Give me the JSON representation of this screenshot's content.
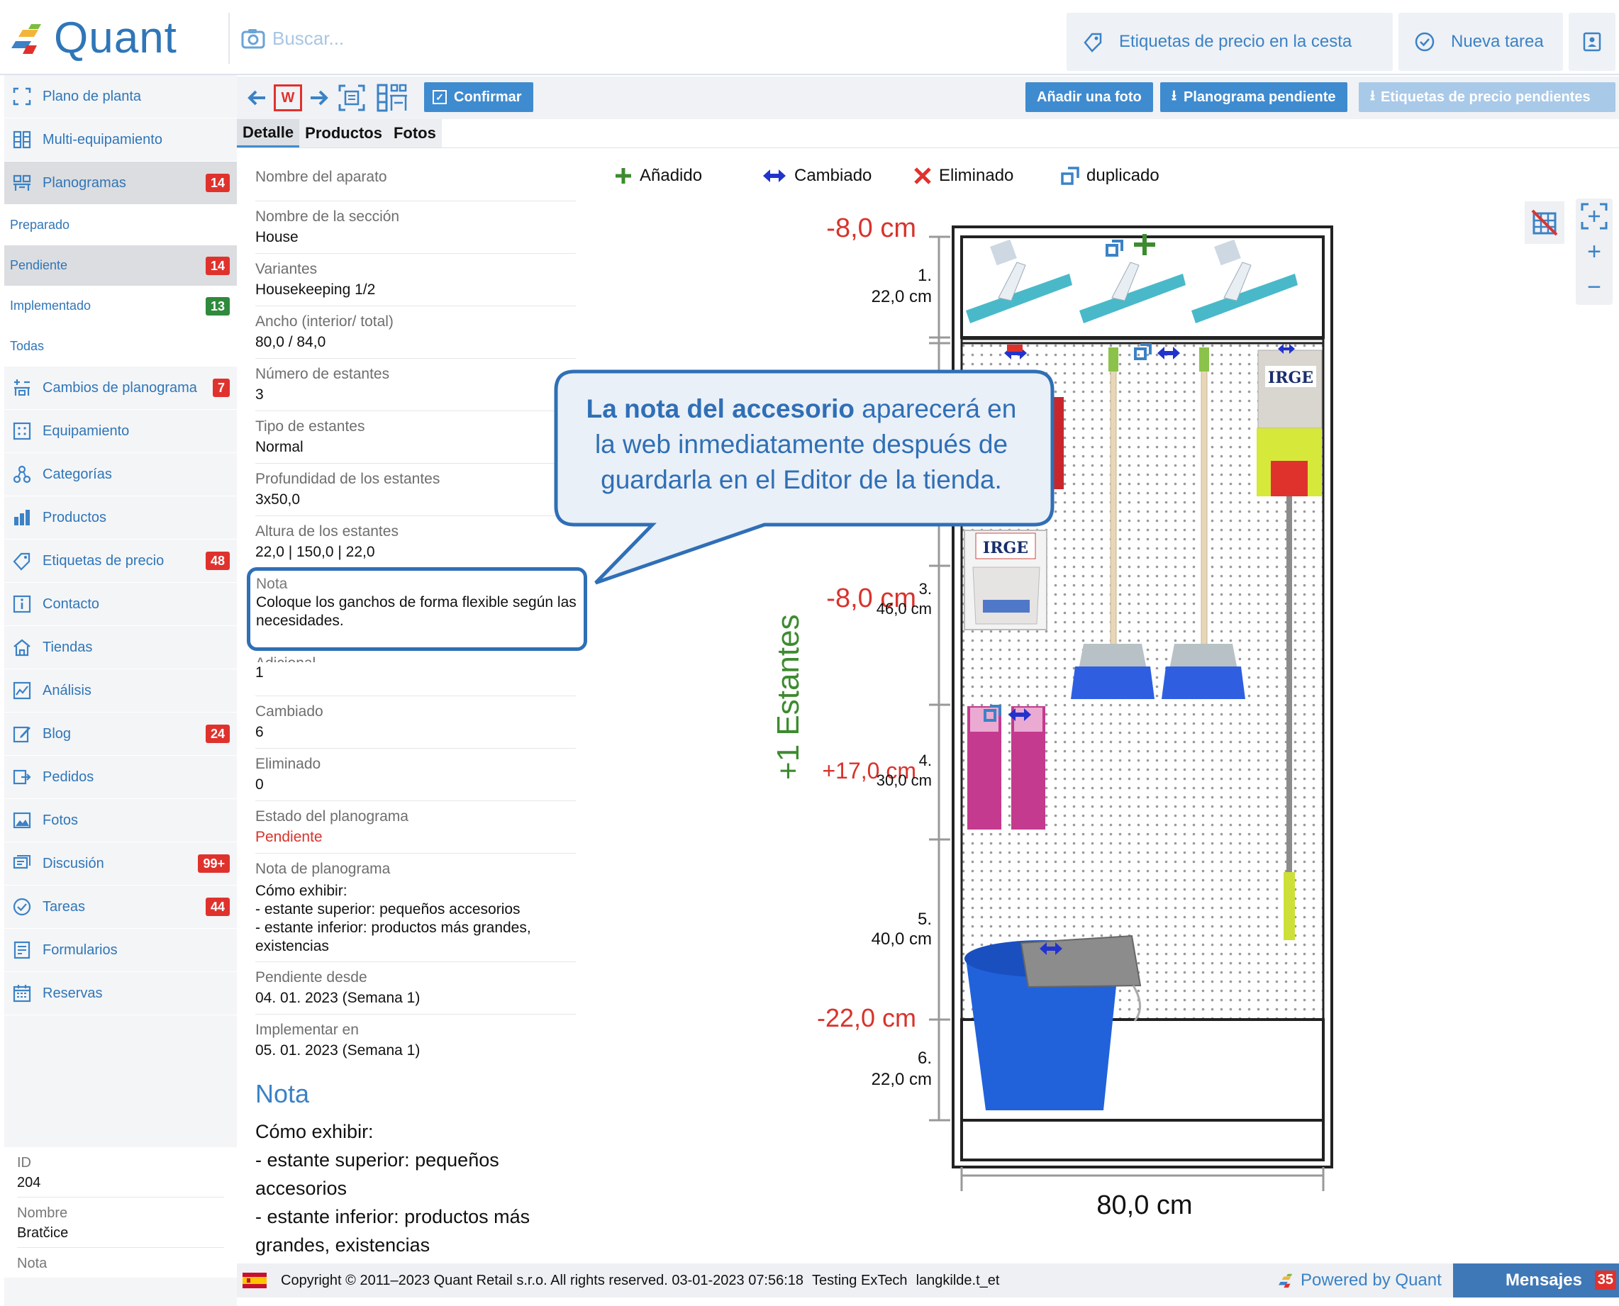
{
  "app": {
    "name": "Quant"
  },
  "search": {
    "placeholder": "Buscar..."
  },
  "header_buttons": {
    "price_tags_basket": "Etiquetas de precio en la cesta",
    "new_task": "Nueva tarea"
  },
  "sidebar": {
    "items": [
      {
        "label": "Plano de planta",
        "icon": "floorplan-icon"
      },
      {
        "label": "Multi-equipamiento",
        "icon": "multi-equipment-icon"
      },
      {
        "label": "Planogramas",
        "icon": "planogram-icon",
        "badge": "14",
        "active": true
      },
      {
        "label": "Cambios de planograma",
        "icon": "planogram-changes-icon",
        "badge": "7"
      },
      {
        "label": "Equipamiento",
        "icon": "equipment-icon"
      },
      {
        "label": "Categorías",
        "icon": "categories-icon"
      },
      {
        "label": "Productos",
        "icon": "products-icon"
      },
      {
        "label": "Etiquetas de precio",
        "icon": "price-tag-icon",
        "badge": "48"
      },
      {
        "label": "Contacto",
        "icon": "contact-icon"
      },
      {
        "label": "Tiendas",
        "icon": "stores-icon"
      },
      {
        "label": "Análisis",
        "icon": "analytics-icon"
      },
      {
        "label": "Blog",
        "icon": "blog-icon",
        "badge": "24"
      },
      {
        "label": "Pedidos",
        "icon": "orders-icon"
      },
      {
        "label": "Fotos",
        "icon": "photos-icon"
      },
      {
        "label": "Discusión",
        "icon": "discussion-icon",
        "badge": "99+"
      },
      {
        "label": "Tareas",
        "icon": "tasks-icon",
        "badge": "44"
      },
      {
        "label": "Formularios",
        "icon": "forms-icon"
      },
      {
        "label": "Reservas",
        "icon": "reservations-icon"
      }
    ],
    "sub_items": [
      {
        "label": "Preparado"
      },
      {
        "label": "Pendiente",
        "badge": "14",
        "active": true
      },
      {
        "label": "Implementado",
        "badge": "13"
      },
      {
        "label": "Todas"
      }
    ],
    "info": [
      {
        "label": "ID",
        "value": "204"
      },
      {
        "label": "Nombre",
        "value": "Bratčice"
      },
      {
        "label": "Nota",
        "value": ""
      }
    ]
  },
  "toolbar": {
    "confirm": "Confirmar",
    "add_photo": "Añadir una foto",
    "pending_planogram": "Planograma pendiente",
    "pending_price_tags": "Etiquetas de precio pendientes",
    "w_label": "W"
  },
  "tabs": [
    {
      "label": "Detalle",
      "active": true
    },
    {
      "label": "Productos"
    },
    {
      "label": "Fotos"
    }
  ],
  "details": [
    {
      "label": "Nombre del aparato",
      "value": ""
    },
    {
      "label": "Nombre de la sección",
      "value": "House"
    },
    {
      "label": "Variantes",
      "value": "Housekeeping 1/2"
    },
    {
      "label": "Ancho (interior/ total)",
      "value": "80,0 / 84,0"
    },
    {
      "label": "Número de estantes",
      "value": "3"
    },
    {
      "label": "Tipo de estantes",
      "value": "Normal"
    },
    {
      "label": "Profundidad de los estantes",
      "value": "3x50,0"
    },
    {
      "label": "Altura de los estantes",
      "value": "22,0 | 150,0 | 22,0"
    }
  ],
  "note_field": {
    "label": "Nota",
    "value": "Coloque los ganchos de forma flexible según las necesidades."
  },
  "details2": [
    {
      "label": "Adicional",
      "value": "1"
    },
    {
      "label": "Cambiado",
      "value": "6"
    },
    {
      "label": "Eliminado",
      "value": "0"
    },
    {
      "label": "Estado del planograma",
      "value": "Pendiente"
    }
  ],
  "planogram_note": {
    "label": "Nota de planograma",
    "lines": [
      "Cómo exhibir:",
      "- estante superior: pequeños accesorios",
      "- estante inferior: productos más grandes,",
      "existencias"
    ]
  },
  "dates": [
    {
      "label": "Pendiente desde",
      "value": "04. 01. 2023 (Semana 1)"
    },
    {
      "label": "Implementar en",
      "value": "05. 01. 2023 (Semana 1)"
    }
  ],
  "note_section": {
    "title": "Nota",
    "lines": [
      "Cómo exhibir:",
      "- estante superior: pequeños",
      "accesorios",
      "- estante inferior: productos más",
      "grandes, existencias"
    ]
  },
  "legend": {
    "added": "Añadido",
    "changed": "Cambiado",
    "removed": "Eliminado",
    "duplicated": "duplicado"
  },
  "callout": {
    "bold": "La nota del accesorio",
    "rest_1": " aparecerá en",
    "line_2": "la web inmediatamente después de",
    "line_3": "guardarla en el Editor de la tienda."
  },
  "planogram": {
    "shelves_delta_label": "+1 Estantes",
    "width_label": "80,0 cm",
    "deltas": [
      "-8,0 cm",
      "-8,0 cm",
      "+17,0 cm",
      "-22,0 cm"
    ],
    "shelves": [
      {
        "num": "1.",
        "height": "22,0 cm"
      },
      {
        "num": "3.",
        "height": "46,0 cm"
      },
      {
        "num": "4.",
        "height": "30,0 cm"
      },
      {
        "num": "5.",
        "height": "40,0 cm"
      },
      {
        "num": "6.",
        "height": "22,0 cm"
      }
    ],
    "product_brand": "IRGE",
    "colors": {
      "delta_red": "#d8332c",
      "shelves_green": "#3d8b2f",
      "changed_blue": "#2233cc",
      "accent_blue": "#3f8bd0"
    }
  },
  "footer": {
    "copyright": "Copyright © 2011–2023 Quant Retail s.r.o. All rights reserved. 03-01-2023 07:56:18",
    "env": "Testing ExTech",
    "user": "langkilde.t_et",
    "powered": "Powered by Quant",
    "messages": "Mensajes",
    "messages_badge": "35"
  }
}
